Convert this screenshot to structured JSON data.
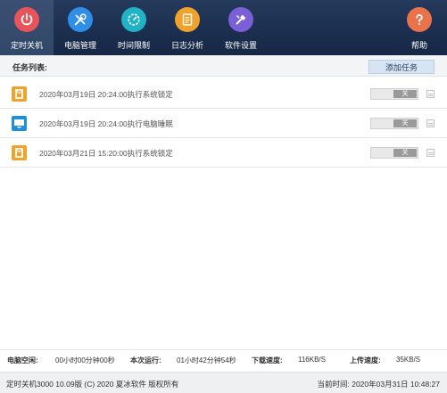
{
  "toolbar": {
    "items": [
      {
        "label": "定时关机",
        "icon": "power-icon",
        "color": "#e8545a"
      },
      {
        "label": "电脑管理",
        "icon": "tools-icon",
        "color": "#2f8fe8"
      },
      {
        "label": "时间限制",
        "icon": "timer-icon",
        "color": "#20b2c5"
      },
      {
        "label": "日志分析",
        "icon": "log-icon",
        "color": "#f0a22a"
      },
      {
        "label": "软件设置",
        "icon": "settings-icon",
        "color": "#7a5fd6"
      }
    ],
    "help": {
      "label": "帮助",
      "icon": "help-icon",
      "color": "#e9734a"
    }
  },
  "task_list": {
    "title": "任务列表:",
    "add_label": "添加任务",
    "rows": [
      {
        "text": "2020年03月19日 20:24:00执行系统锁定",
        "toggle": "关",
        "icon": "lock-file-icon",
        "icon_color": "#f0a22a"
      },
      {
        "text": "2020年03月19日 20:24:00执行电脑睡眠",
        "toggle": "关",
        "icon": "monitor-icon",
        "icon_color": "#1e8fd8"
      },
      {
        "text": "2020年03月21日 15:20:00执行系统锁定",
        "toggle": "关",
        "icon": "lock-file-icon",
        "icon_color": "#f0a22a"
      }
    ]
  },
  "stats": {
    "idle_label": "电脑空闲:",
    "idle_value": "00小时00分钟00秒",
    "run_label": "本次运行:",
    "run_value": "01小时42分钟54秒",
    "down_label": "下载速度:",
    "down_value": "116KB/S",
    "up_label": "上传速度:",
    "up_value": "35KB/S"
  },
  "status_bar": {
    "version": "定时关机3000 10.09版 (C) 2020 夏冰软件 版权所有",
    "current_time": "当前时间: 2020年03月31日 10:48:27"
  }
}
